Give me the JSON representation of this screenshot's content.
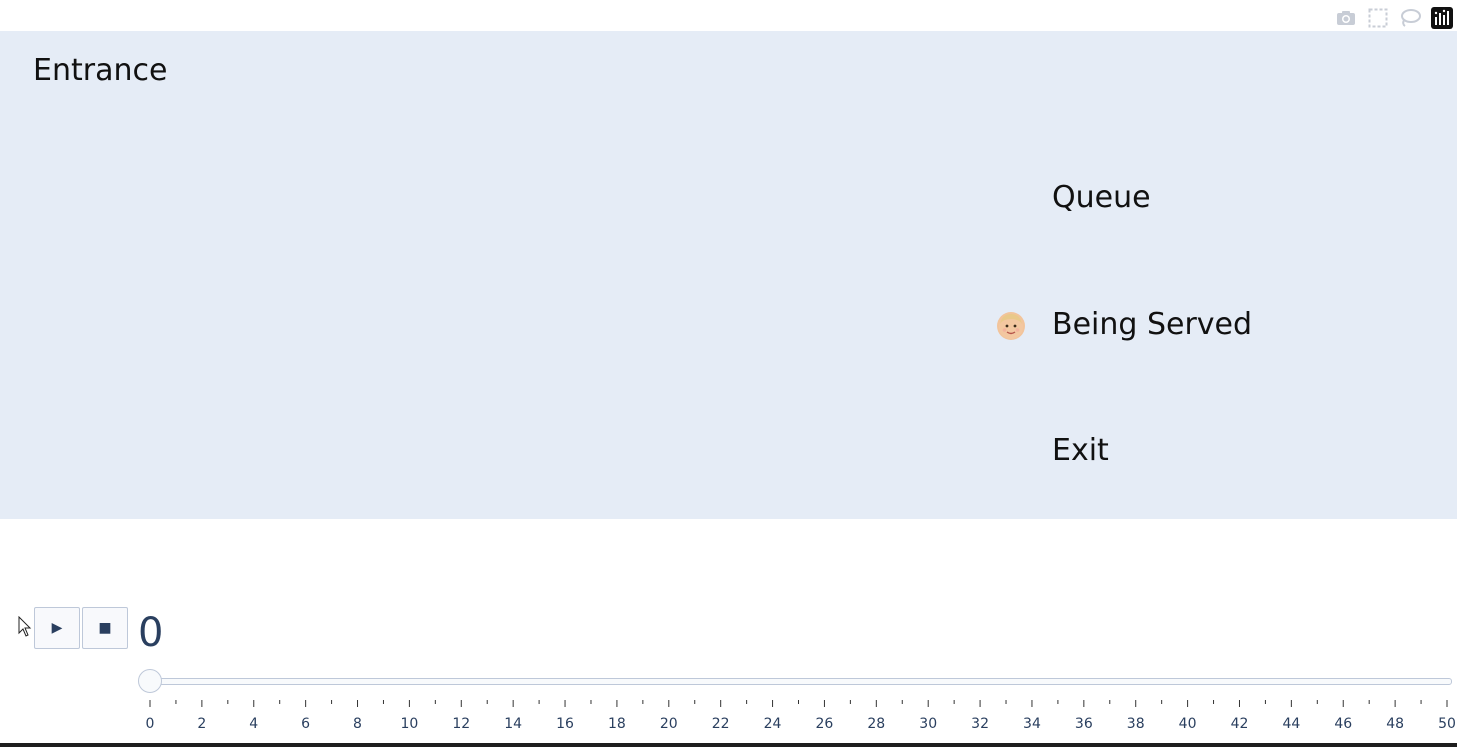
{
  "modebar": {
    "buttons": [
      {
        "name": "camera-icon",
        "title": "Download plot as a png"
      },
      {
        "name": "box-select-icon",
        "title": "Box Select"
      },
      {
        "name": "lasso-select-icon",
        "title": "Lasso Select"
      },
      {
        "name": "plotly-logo-icon",
        "title": "Produced with Plotly"
      }
    ]
  },
  "stages": {
    "entrance": "Entrance",
    "queue": "Queue",
    "being_served": "Being Served",
    "exit": "Exit"
  },
  "customers": [
    {
      "icon": "person-face-emoji",
      "stage": "being_served"
    }
  ],
  "controls": {
    "play_icon": "▶",
    "stop_icon": "■"
  },
  "slider": {
    "current_value": "0",
    "min": 0,
    "max": 50,
    "step": 1,
    "labels": [
      "0",
      "2",
      "4",
      "6",
      "8",
      "10",
      "12",
      "14",
      "16",
      "18",
      "20",
      "22",
      "24",
      "26",
      "28",
      "30",
      "32",
      "34",
      "36",
      "38",
      "40",
      "42",
      "44",
      "46",
      "48",
      "50"
    ]
  },
  "colors": {
    "plot_background": "#e5ecf6",
    "text": "#2a3f5f",
    "slider_border": "#bec8d9"
  }
}
